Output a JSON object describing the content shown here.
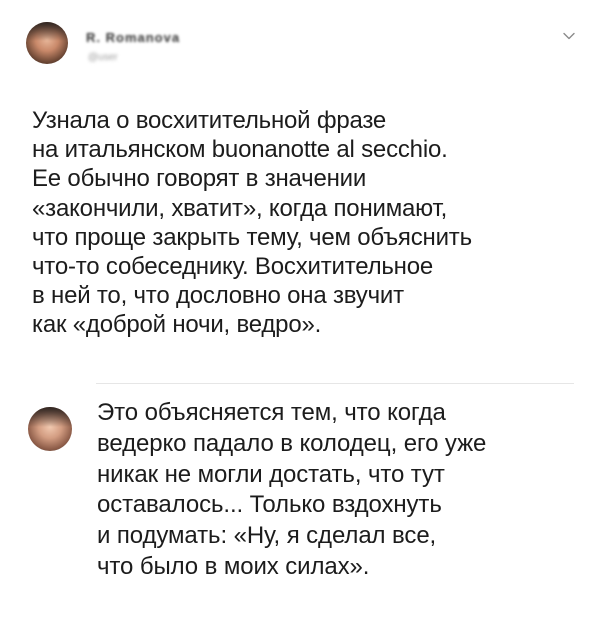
{
  "tweet": {
    "author_name": "R. Romanova",
    "author_handle": "@user",
    "text_lines": [
      "Узнала о восхитительной фразе",
      "на итальянском buonanotte al secchio.",
      "Ее обычно говорят в значении",
      "«закончили, хватит», когда понимают,",
      "что проще закрыть тему, чем объяснить",
      "что-то собеседнику. Восхитительное",
      "в ней то, что дословно она звучит",
      "как «доброй ночи, ведро»."
    ]
  },
  "reply": {
    "text_lines": [
      "Это объясняется тем, что когда",
      "ведерко падало в колодец, его уже",
      "никак не могли достать, что тут",
      "оставалось... Только вздохнуть",
      "и подумать: «Ну, я сделал все,",
      "что было в моих силах»."
    ]
  },
  "icons": {
    "menu": "chevron-down-icon"
  }
}
